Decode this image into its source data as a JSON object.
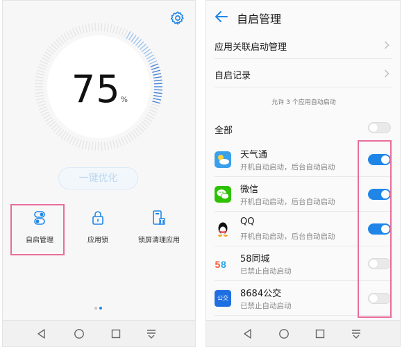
{
  "left": {
    "score": "75",
    "score_unit": "%",
    "gauge_level": 0.75,
    "optimize_button": "一键优化",
    "features": [
      {
        "label": "自启管理",
        "icon": "toggle-switch-icon"
      },
      {
        "label": "应用锁",
        "icon": "padlock-icon"
      },
      {
        "label": "锁屏清理应用",
        "icon": "lock-screen-clean-icon"
      }
    ],
    "settings_icon": "gear-icon",
    "page_indicator": {
      "pages": 2,
      "current": 2
    }
  },
  "right": {
    "title": "自启管理",
    "rows": [
      {
        "label": "应用关联启动管理"
      },
      {
        "label": "自启记录"
      }
    ],
    "note": "允许 3 个应用自动启动",
    "all_label": "全部",
    "all_toggle": false,
    "apps": [
      {
        "name": "天气通",
        "status": "开机自动启动，后台自动启动",
        "enabled": true,
        "icon": "weather-app-icon"
      },
      {
        "name": "微信",
        "status": "开机自动启动，后台自动启动",
        "enabled": true,
        "icon": "wechat-icon"
      },
      {
        "name": "QQ",
        "status": "开机自动启动，后台自动启动",
        "enabled": true,
        "icon": "qq-penguin-icon"
      },
      {
        "name": "58同城",
        "status": "已禁止自动启动",
        "enabled": false,
        "icon": "58-tongcheng-icon"
      },
      {
        "name": "8684公交",
        "status": "已禁止自动启动",
        "enabled": false,
        "icon": "8684-bus-icon",
        "icon_text": "公交"
      }
    ]
  },
  "navbar": {
    "icons": [
      "back-triangle-icon",
      "home-circle-icon",
      "recents-square-icon",
      "notification-pull-icon"
    ]
  },
  "colors": {
    "accent": "#1f86e8",
    "highlight": "#e76e9a",
    "toggle_off": "#e9e9e9"
  }
}
